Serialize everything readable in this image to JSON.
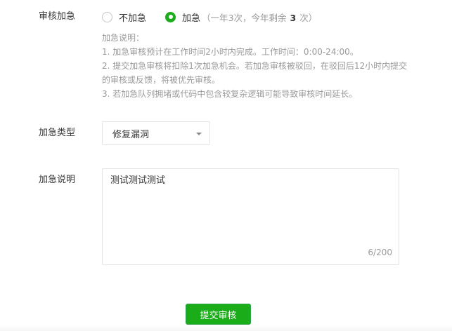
{
  "urgent": {
    "label": "审核加急",
    "options": [
      {
        "label": "不加急",
        "checked": false
      },
      {
        "label": "加急",
        "checked": true
      }
    ],
    "quota_prefix": "（一年3次，今年剩余",
    "quota_remaining": "3",
    "quota_suffix": "次）",
    "description": [
      "加急说明：",
      "1. 加急审核预计在工作时间2小时内完成。工作时间：0:00-24:00。",
      "2. 提交加急审核将扣除1次加急机会。若加急审核被驳回，在驳回后12小时内提交的审核或反馈，将被优先审核。",
      "3. 若加急队列拥堵或代码中包含较复杂逻辑可能导致审核时间延长。"
    ]
  },
  "urgent_type": {
    "label": "加急类型",
    "selected": "修复漏洞"
  },
  "urgent_note": {
    "label": "加急说明",
    "value": "测试测试测试",
    "counter": "6/200"
  },
  "submit_label": "提交审核",
  "colors": {
    "brand_green": "#1aad19",
    "muted_text": "#9a9a9a",
    "border": "#e4e4e4"
  }
}
